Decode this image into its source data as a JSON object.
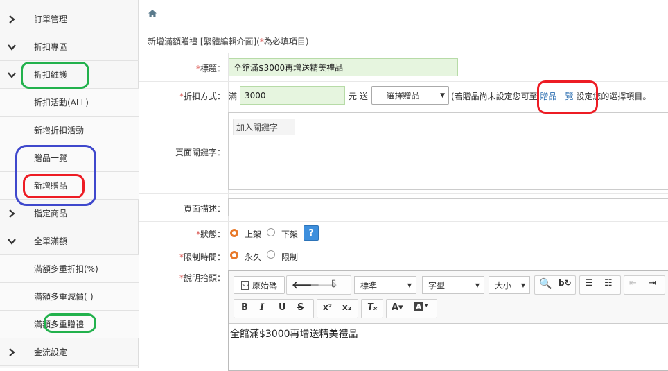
{
  "sidebar": {
    "items": [
      {
        "label": "訂單管理",
        "chevron": "right"
      },
      {
        "label": "折扣專區",
        "chevron": "down"
      },
      {
        "label": "折扣維護",
        "chevron": "down"
      },
      {
        "label": "折扣活動(ALL)"
      },
      {
        "label": "新增折扣活動"
      },
      {
        "label": "贈品一覽"
      },
      {
        "label": "新增贈品"
      },
      {
        "label": "指定商品",
        "chevron": "right"
      },
      {
        "label": "全單滿額",
        "chevron": "down"
      },
      {
        "label": "滿額多重折扣(%)"
      },
      {
        "label": "滿額多重減價(-)"
      },
      {
        "label": "滿額多重贈禮"
      },
      {
        "label": "金流設定",
        "chevron": "right"
      }
    ]
  },
  "header": {
    "title_main": "新增滿額贈禮 [繁體編輯介面](",
    "title_req": "*",
    "title_tail": "為必填項目)"
  },
  "form": {
    "title_label": "標題：",
    "title_value": "全館滿$3000再增送精美禮品",
    "discount_label": "折扣方式：",
    "full_prefix": "滿",
    "amount_value": "3000",
    "unit_text": "元 送",
    "gift_select": "-- 選擇贈品 --",
    "hint_pre": "(若贈品尚未設定您可至",
    "hint_link": "贈品一覽",
    "hint_post": "設定您的選擇項目。",
    "keyword_label": "頁面關鍵字：",
    "keyword_tag": "加入關鍵字",
    "desc_label": "頁面描述：",
    "desc_value": "",
    "status_label": "狀態：",
    "status_on": "上架",
    "status_off": "下架",
    "help": "?",
    "time_label": "限制時間：",
    "time_forever": "永久",
    "time_limit": "限制",
    "heading_label": "說明抬頭："
  },
  "editor": {
    "source_btn": "原始碼",
    "format_combo": "標準",
    "font_combo": "字型",
    "size_combo": "大小",
    "content": "全館滿$3000再增送精美禮品"
  },
  "colors": {
    "required": "#d9534f",
    "link": "#2a6db0",
    "radio_on": "#e8792a",
    "anno_green": "#22b14c",
    "anno_blue": "#3f48cc",
    "anno_red": "#ed1c24"
  }
}
